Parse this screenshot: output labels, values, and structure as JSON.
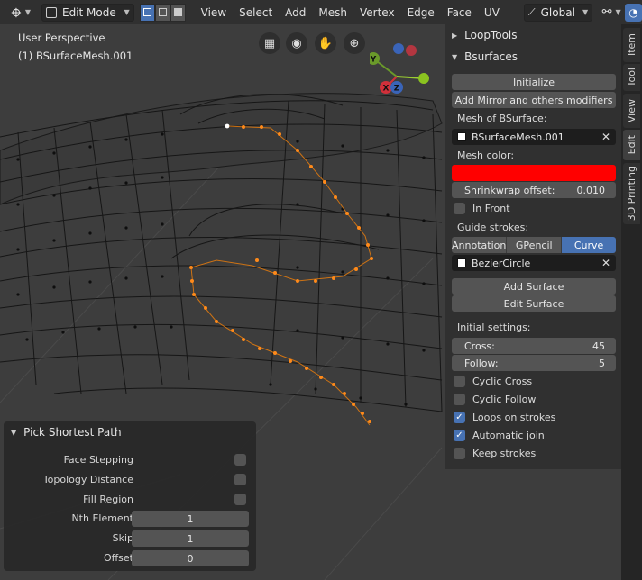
{
  "header": {
    "mode": "Edit Mode",
    "menus": [
      "View",
      "Select",
      "Add",
      "Mesh",
      "Vertex",
      "Edge",
      "Face",
      "UV"
    ],
    "transform_orientation": "Global"
  },
  "viewport": {
    "perspective_label": "User Perspective",
    "object_label": "(1) BSurfaceMesh.001",
    "gizmo": {
      "x": "X",
      "y": "Y",
      "z": "Z"
    }
  },
  "loop_tools": {
    "title": "LoopTools"
  },
  "bsurfaces": {
    "title": "Bsurfaces",
    "initialize_label": "Initialize",
    "add_mirror_label": "Add Mirror and others modifiers",
    "mesh_label": "Mesh of BSurface:",
    "mesh_value": "BSurfaceMesh.001",
    "mesh_color_label": "Mesh color:",
    "mesh_color": "#ff0000",
    "shrinkwrap_label": "Shrinkwrap offset:",
    "shrinkwrap_value": "0.010",
    "in_front_label": "In Front",
    "guide_label": "Guide strokes:",
    "guide_tabs": [
      "Annotation",
      "GPencil",
      "Curve"
    ],
    "guide_active": "Curve",
    "curve_value": "BezierCircle",
    "add_surface_label": "Add Surface",
    "edit_surface_label": "Edit Surface",
    "initial_label": "Initial settings:",
    "cross_label": "Cross:",
    "cross_value": "45",
    "follow_label": "Follow:",
    "follow_value": "5",
    "checks": [
      {
        "label": "Cyclic Cross",
        "checked": false
      },
      {
        "label": "Cyclic Follow",
        "checked": false
      },
      {
        "label": "Loops on strokes",
        "checked": true
      },
      {
        "label": "Automatic join",
        "checked": true
      },
      {
        "label": "Keep strokes",
        "checked": false
      }
    ]
  },
  "tabs": [
    "Item",
    "Tool",
    "View",
    "Edit",
    "3D Printing"
  ],
  "active_tab": "Edit",
  "operator": {
    "title": "Pick Shortest Path",
    "face_stepping": "Face Stepping",
    "topology_distance": "Topology Distance",
    "fill_region": "Fill Region",
    "nth_label": "Nth Element",
    "nth_value": "1",
    "skip_label": "Skip",
    "skip_value": "1",
    "offset_label": "Offset",
    "offset_value": "0"
  },
  "colors": {
    "accent": "#4772b3",
    "selected_path": "#e87d0d"
  }
}
